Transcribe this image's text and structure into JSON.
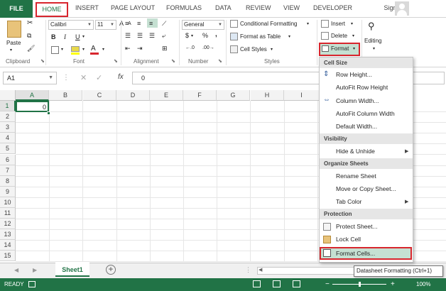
{
  "tabs": [
    "FILE",
    "HOME",
    "INSERT",
    "PAGE LAYOUT",
    "FORMULAS",
    "DATA",
    "REVIEW",
    "VIEW",
    "DEVELOPER"
  ],
  "signin": "Sign in",
  "ribbon": {
    "paste": "Paste",
    "clipboard": "Clipboard",
    "font_name": "Calibri",
    "font_size": "11",
    "font": "Font",
    "alignment": "Alignment",
    "number_format": "General",
    "number": "Number",
    "conditional_formatting": "Conditional Formatting",
    "format_as_table": "Format as Table",
    "cell_styles": "Cell Styles",
    "styles": "Styles",
    "insert": "Insert",
    "delete": "Delete",
    "format": "Format",
    "editing": "Editing",
    "bold": "B",
    "italic": "I",
    "underline": "U",
    "font_color_letter": "A",
    "grow_letter": "A",
    "shrink_letter": "A",
    "percent": "%",
    "dollar": "$",
    "comma": ","
  },
  "formula_bar": {
    "name_box": "A1",
    "fx": "fx",
    "value": "0"
  },
  "grid": {
    "columns": [
      "A",
      "B",
      "C",
      "D",
      "E",
      "F",
      "G",
      "H",
      "I"
    ],
    "rows": [
      "1",
      "2",
      "3",
      "4",
      "5",
      "6",
      "7",
      "8",
      "9",
      "10",
      "11",
      "12",
      "13",
      "14",
      "15"
    ],
    "a1_value": "0"
  },
  "sheet_tab": "Sheet1",
  "status": {
    "ready": "READY",
    "zoom": "100%"
  },
  "menu": {
    "sections": {
      "cell_size": "Cell Size",
      "visibility": "Visibility",
      "organize": "Organize Sheets",
      "protection": "Protection"
    },
    "items": {
      "row_height": "Row Height...",
      "autofit_row": "AutoFit Row Height",
      "column_width": "Column Width...",
      "autofit_column": "AutoFit Column Width",
      "default_width": "Default Width...",
      "hide_unhide": "Hide & Unhide",
      "rename_sheet": "Rename Sheet",
      "move_copy": "Move or Copy Sheet...",
      "tab_color": "Tab Color",
      "protect_sheet": "Protect Sheet...",
      "lock_cell": "Lock Cell",
      "format_cells": "Format Cells..."
    }
  },
  "tooltip": "Datasheet Formatting (Ctrl+1)",
  "colors": {
    "excel_green": "#217346",
    "highlight_red": "#d8262e",
    "hover_green": "#c5e0d2"
  }
}
